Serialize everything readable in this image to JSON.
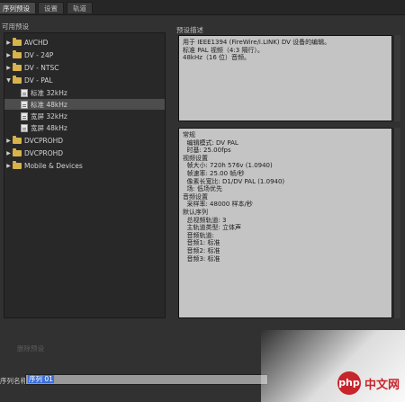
{
  "tabs": [
    {
      "label": "序列预设",
      "active": true
    },
    {
      "label": "设置",
      "active": false
    },
    {
      "label": "轨道",
      "active": false
    }
  ],
  "presets_panel": {
    "label": "可用预设"
  },
  "tree": [
    {
      "label": "AVCHD",
      "type": "folder",
      "level": 0,
      "expanded": false,
      "selected": false
    },
    {
      "label": "DV - 24P",
      "type": "folder",
      "level": 0,
      "expanded": false,
      "selected": false
    },
    {
      "label": "DV - NTSC",
      "type": "folder",
      "level": 0,
      "expanded": false,
      "selected": false
    },
    {
      "label": "DV - PAL",
      "type": "folder",
      "level": 0,
      "expanded": true,
      "selected": false
    },
    {
      "label": "标准 32kHz",
      "type": "file",
      "level": 1,
      "selected": false
    },
    {
      "label": "标准 48kHz",
      "type": "file",
      "level": 1,
      "selected": true
    },
    {
      "label": "宽屏 32kHz",
      "type": "file",
      "level": 1,
      "selected": false
    },
    {
      "label": "宽屏 48kHz",
      "type": "file",
      "level": 1,
      "selected": false
    },
    {
      "label": "DVCPROHD",
      "type": "folder",
      "level": 0,
      "expanded": false,
      "selected": false
    },
    {
      "label": "DVCPROHD",
      "type": "folder",
      "level": 0,
      "expanded": false,
      "selected": false
    },
    {
      "label": "Mobile & Devices",
      "type": "folder",
      "level": 0,
      "expanded": false,
      "selected": false
    }
  ],
  "description_panel": {
    "label": "预设描述",
    "lines": [
      "用于 IEEE1394 (FireWire/i.LINK) DV 设备的编辑。",
      "标准 PAL 视频（4:3 隔行）。",
      "48kHz（16 位）音频。"
    ]
  },
  "details": {
    "lines": [
      "常规",
      "  编辑模式: DV PAL",
      "  时基: 25.00fps",
      "",
      "视频设置",
      "  帧大小: 720h 576v (1.0940)",
      "  帧速率: 25.00 帧/秒",
      "  像素长宽比: D1/DV PAL (1.0940)",
      "  场: 低场优先",
      "",
      "音频设置",
      "  采样率: 48000 样本/秒",
      "",
      "默认序列",
      "  总视频轨道: 3",
      "  主轨道类型: 立体声",
      "  音频轨道:",
      "  音频1: 标准",
      "  音频2: 标准",
      "  音频3: 标准"
    ]
  },
  "import_button": {
    "label": "删除预设"
  },
  "sequence_name": {
    "label": "序列名称:",
    "value": "序列 01"
  },
  "watermark": {
    "logo": "php",
    "text": "中文网"
  }
}
